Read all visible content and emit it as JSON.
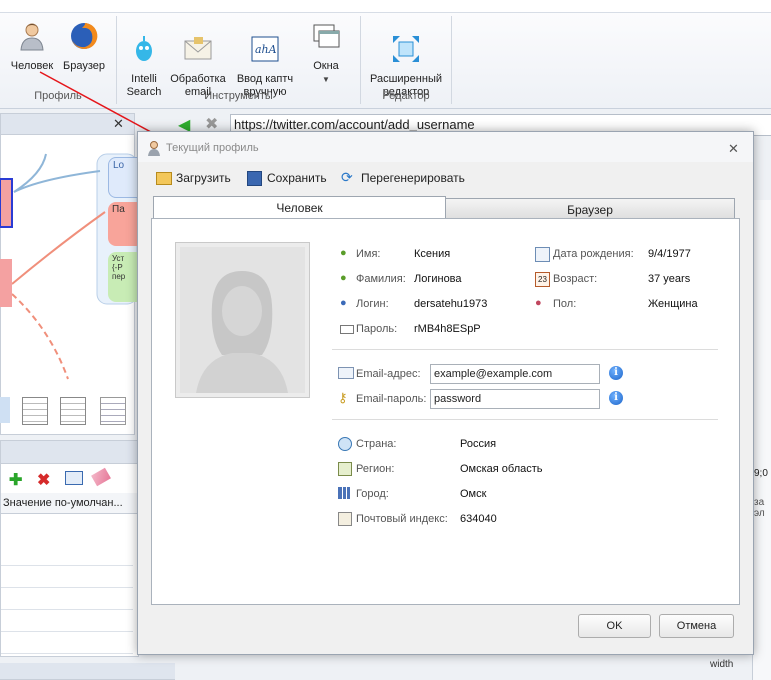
{
  "ribbon": {
    "profile": {
      "person_label": "Человек",
      "browser_label": "Браузер",
      "group_label": "Профиль"
    },
    "tools": {
      "intelli_label": "Intelli\nSearch",
      "email_label": "Обработка\nemail",
      "captcha_label": "Ввод каптч\nвручную",
      "windows_label": "Окна",
      "group_label": "Инструменты"
    },
    "editor": {
      "advanced_label": "Расширенный\nредактор",
      "group_label": "Редактор"
    }
  },
  "background": {
    "url": "https://twitter.com/account/add_username",
    "node_lo": "Lo",
    "node_pa": "Па",
    "node_us": "Уст\n{-P\nпер",
    "table_header": "Значение по-умолчан...",
    "right_text_1": "9;0",
    "right_text_2": "за эл",
    "right_text_3": "width"
  },
  "dialog": {
    "title": "Текущий профиль",
    "toolbar": {
      "load": "Загрузить",
      "save": "Сохранить",
      "regen": "Перегенерировать"
    },
    "tabs": {
      "person": "Человек",
      "browser": "Браузер"
    },
    "person": {
      "name_label": "Имя:",
      "name": "Ксения",
      "surname_label": "Фамилия:",
      "surname": "Логинова",
      "login_label": "Логин:",
      "login": "dersatehu1973",
      "password_label": "Пароль:",
      "password": "rMB4h8ESpP",
      "birth_label": "Дата рождения:",
      "birth": "9/4/1977",
      "age_label": "Возраст:",
      "age": "37 years",
      "sex_label": "Пол:",
      "sex": "Женщина"
    },
    "email": {
      "address_label": "Email-адрес:",
      "address": "example@example.com",
      "password_label": "Email-пароль:",
      "password": "password"
    },
    "location": {
      "country_label": "Страна:",
      "country": "Россия",
      "region_label": "Регион:",
      "region": "Омская область",
      "city_label": "Город:",
      "city": "Омск",
      "zip_label": "Почтовый индекс:",
      "zip": "634040"
    },
    "ok": "OK",
    "cancel": "Отмена"
  }
}
